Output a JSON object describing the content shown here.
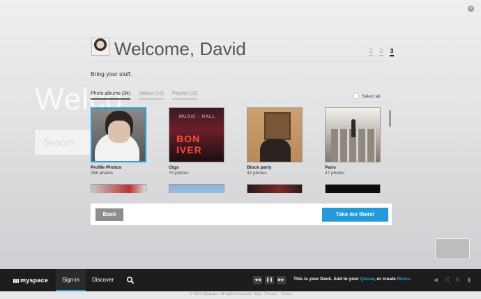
{
  "background": {
    "word": "Welco",
    "search_placeholder": "Search"
  },
  "header": {
    "welcome": "Welcome, David",
    "steps": [
      "1",
      "2",
      "3"
    ],
    "active_step": 3,
    "subtitle": "Bring your stuff."
  },
  "tabs": [
    {
      "label": "Photo albums (34)",
      "active": true
    },
    {
      "label": "Videos (10)",
      "active": false
    },
    {
      "label": "Playlist (15)",
      "active": false
    }
  ],
  "select_all_label": "Select all",
  "albums": [
    {
      "name": "Profile Photos",
      "count": "256 photos",
      "selected": true
    },
    {
      "name": "Gigs",
      "count": "74 photos",
      "selected": false,
      "sign_top": "MUSIC - HALL",
      "sign_main": "BON IVER"
    },
    {
      "name": "Block party",
      "count": "32 photos",
      "selected": false
    },
    {
      "name": "Paris",
      "count": "47 photos",
      "selected": false
    }
  ],
  "buttons": {
    "back": "Back",
    "proceed": "Take me there!"
  },
  "bottom_bar": {
    "logo": "myspace",
    "signin": "Sign-in",
    "discover": "Discover",
    "deck_prefix": "This is your Deck. Add to your ",
    "deck_queue": "Queue",
    "deck_middle": ", or create ",
    "deck_mixes": "Mixes",
    "deck_suffix": "."
  },
  "copyright": "© 2012 Myspace. All rights reserved. Help · Privacy · Terms",
  "colors": {
    "accent": "#2d9bd5",
    "button_blue": "#249bd8",
    "bar": "#1d1d1f"
  }
}
